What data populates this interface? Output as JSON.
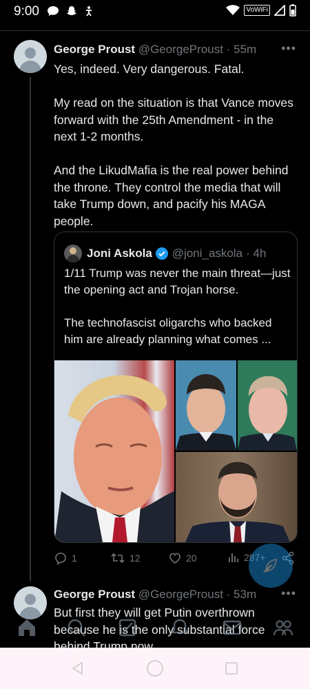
{
  "status_bar": {
    "time": "9:00",
    "network_label": "VoWiFi"
  },
  "tweet1": {
    "name": "George Proust",
    "handle": "@GeorgeProust",
    "time": "· 55m",
    "text": "Yes, indeed.  Very dangerous.  Fatal.\n\nMy read on the situation is that Vance moves forward with the 25th Amendment - in the next 1-2 months.\n\nAnd the LikudMafia is the real power behind the throne.  They control the media that will take Trump down, and pacify his MAGA people."
  },
  "quote": {
    "name": "Joni Askola",
    "handle": "@joni_askola",
    "time": "· 4h",
    "text": "1/11 Trump was never the main threat—just the opening act and Trojan horse.\n\nThe technofascist oligarchs who backed him are already planning what comes ..."
  },
  "actions": {
    "replies": "1",
    "reposts": "12",
    "likes": "20",
    "views": "287+"
  },
  "tweet2": {
    "name": "George Proust",
    "handle": "@GeorgeProust",
    "time": "· 53m",
    "text": "But first they will get Putin overthrown because he is the only substantial force behind Trump now."
  },
  "icons": {
    "home": "home-icon",
    "search": "search-icon",
    "grok": "grok-icon",
    "notifications": "bell-icon",
    "messages": "mail-icon",
    "communities": "people-icon",
    "compose": "feather-icon"
  },
  "colors": {
    "accent": "#1d9bf0",
    "background": "#000000",
    "text": "#e7e9ea",
    "muted": "#71767b"
  }
}
